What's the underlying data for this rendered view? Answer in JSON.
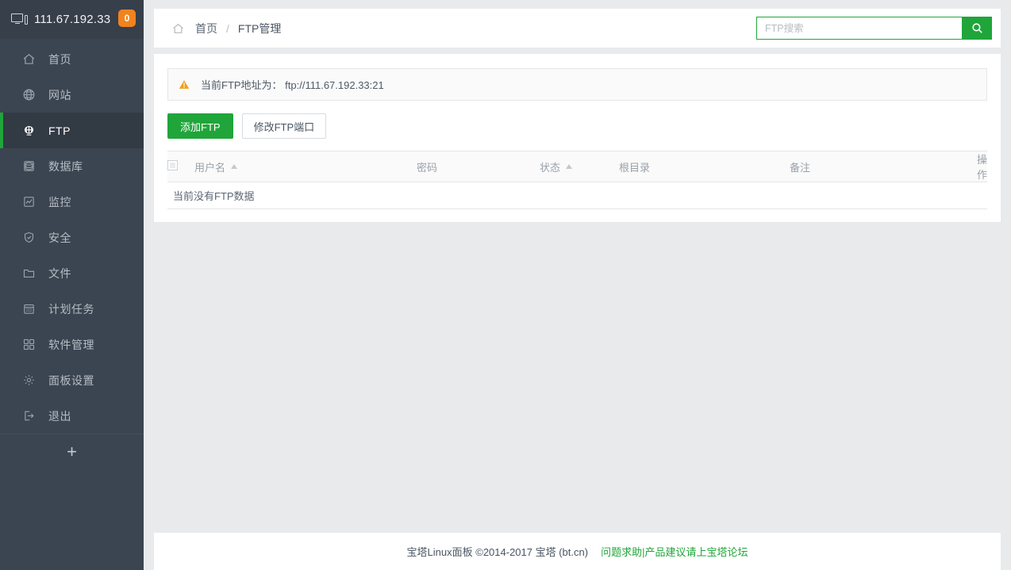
{
  "sidebar": {
    "host": "111.67.192.33",
    "badge": "0",
    "monitor_icon": "monitor-icon",
    "add_label": "+",
    "items": [
      {
        "label": "首页",
        "icon": "home-icon",
        "active": false
      },
      {
        "label": "网站",
        "icon": "globe-icon",
        "active": false
      },
      {
        "label": "FTP",
        "icon": "ftp-icon",
        "active": true
      },
      {
        "label": "数据库",
        "icon": "database-icon",
        "active": false
      },
      {
        "label": "监控",
        "icon": "monitor-chart-icon",
        "active": false
      },
      {
        "label": "安全",
        "icon": "shield-icon",
        "active": false
      },
      {
        "label": "文件",
        "icon": "folder-icon",
        "active": false
      },
      {
        "label": "计划任务",
        "icon": "calendar-icon",
        "active": false
      },
      {
        "label": "软件管理",
        "icon": "apps-icon",
        "active": false
      },
      {
        "label": "面板设置",
        "icon": "gear-icon",
        "active": false
      },
      {
        "label": "退出",
        "icon": "logout-icon",
        "active": false
      }
    ]
  },
  "header": {
    "home_icon": "home-icon",
    "breadcrumb_home": "首页",
    "breadcrumb_sep": "/",
    "breadcrumb_current": "FTP管理"
  },
  "search": {
    "placeholder": "FTP搜索",
    "value": "",
    "icon": "search-icon",
    "button_color": "#20a53a"
  },
  "alert": {
    "icon": "warning-triangle-icon",
    "text": "当前FTP地址为： ftp://111.67.192.33:21",
    "icon_color": "#f0a020"
  },
  "toolbar": {
    "add_ftp_label": "添加FTP",
    "edit_port_label": "修改FTP端口",
    "primary_color": "#20a53a"
  },
  "table": {
    "columns": [
      {
        "label": "用户名",
        "sort": true
      },
      {
        "label": "密码",
        "sort": false
      },
      {
        "label": "状态",
        "sort": true
      },
      {
        "label": "根目录",
        "sort": false
      },
      {
        "label": "备注",
        "sort": false
      },
      {
        "label": "操作",
        "sort": false
      }
    ],
    "rows": [],
    "empty_text": "当前没有FTP数据"
  },
  "footer": {
    "copyright": "宝塔Linux面板 ©2014-2017 宝塔 (bt.cn)",
    "link": "问题求助|产品建议请上宝塔论坛",
    "link_color": "#20a53a"
  }
}
